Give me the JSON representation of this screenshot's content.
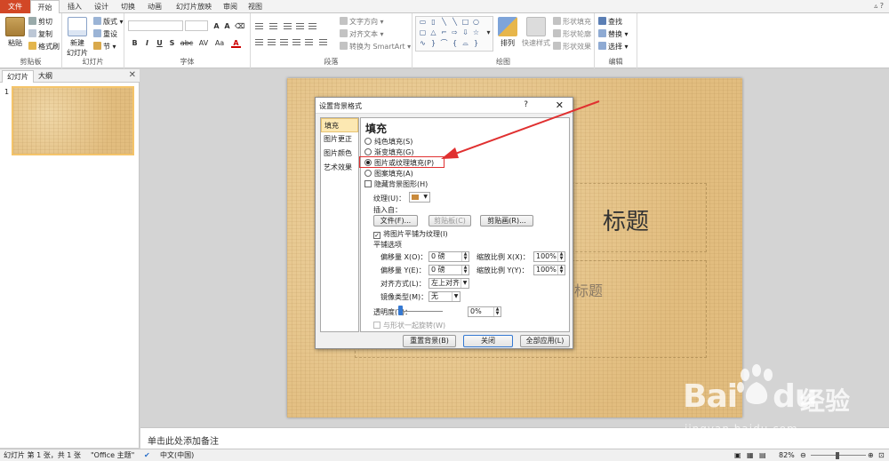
{
  "tabs": [
    "文件",
    "开始",
    "插入",
    "设计",
    "切换",
    "动画",
    "幻灯片放映",
    "审阅",
    "视图"
  ],
  "ribbon": {
    "clipboard": {
      "paste": "粘贴",
      "cut": "剪切",
      "copy": "复制",
      "format_painter": "格式刷",
      "group": "剪贴板"
    },
    "slides": {
      "new_slide": "新建",
      "new_slide2": "幻灯片",
      "layout": "版式",
      "reset": "重设",
      "section": "节",
      "group": "幻灯片"
    },
    "font": {
      "group": "字体",
      "buttons": [
        "B",
        "I",
        "U",
        "S",
        "abc",
        "AV",
        "Aa",
        "A"
      ]
    },
    "paragraph": {
      "group": "段落",
      "text_direction": "文字方向",
      "align_text": "对齐文本",
      "smartart": "转换为 SmartArt"
    },
    "drawing": {
      "group": "绘图",
      "arrange": "排列",
      "quick_styles": "快速样式",
      "shape_fill": "形状填充",
      "shape_outline": "形状轮廓",
      "shape_effects": "形状效果"
    },
    "editing": {
      "group": "编辑",
      "find": "查找",
      "replace": "替换",
      "select": "选择"
    }
  },
  "left_pane": {
    "tab_slides": "幻灯片",
    "tab_outline": "大纲",
    "slide_number": "1"
  },
  "slide": {
    "title_placeholder": "标题",
    "subtitle_placeholder": "标题"
  },
  "notes_placeholder": "单击此处添加备注",
  "status": {
    "slide_info": "幻灯片 第 1 张，共 1 张",
    "theme": "\"Office 主题\"",
    "language": "中文(中国)",
    "zoom": "82%"
  },
  "dialog": {
    "title": "设置背景格式",
    "help": "?",
    "close": "✕",
    "nav": [
      "填充",
      "图片更正",
      "图片颜色",
      "艺术效果"
    ],
    "fill_heading": "填充",
    "fill_options": [
      {
        "label": "纯色填充(S)",
        "selected": false
      },
      {
        "label": "渐变填充(G)",
        "selected": false
      },
      {
        "label": "图片或纹理填充(P)",
        "selected": true
      },
      {
        "label": "图案填充(A)",
        "selected": false
      }
    ],
    "hide_bg": "隐藏背景图形(H)",
    "texture_label": "纹理(U)：",
    "insert_from": "插入自：",
    "btn_file": "文件(F)...",
    "btn_clipboard": "剪贴板(C)",
    "btn_clipart": "剪贴画(R)...",
    "tile_check": "将图片平铺为纹理(I)",
    "tile_options": "平铺选项",
    "offset_x_label": "偏移量 X(O)：",
    "offset_x_value": "0 磅",
    "offset_y_label": "偏移量 Y(E)：",
    "offset_y_value": "0 磅",
    "scale_x_label": "缩放比例 X(X)：",
    "scale_x_value": "100%",
    "scale_y_label": "缩放比例 Y(Y)：",
    "scale_y_value": "100%",
    "align_label": "对齐方式(L)：",
    "align_value": "左上对齐",
    "mirror_label": "镜像类型(M)：",
    "mirror_value": "无",
    "transparency_label": "透明度(T)：",
    "transparency_value": "0%",
    "rotate_with_shape": "与形状一起旋转(W)",
    "btn_reset": "重置背景(B)",
    "btn_close": "关闭",
    "btn_apply_all": "全部应用(L)"
  },
  "watermark": {
    "logo": "Bai",
    "logo2": "du",
    "jingyan": "经验",
    "url": "jingyan.baidu.com"
  },
  "colors": {
    "accent": "#d24726",
    "annotation": "#e03030",
    "selection": "#fce8b2",
    "parchment": "#e7c68c"
  }
}
